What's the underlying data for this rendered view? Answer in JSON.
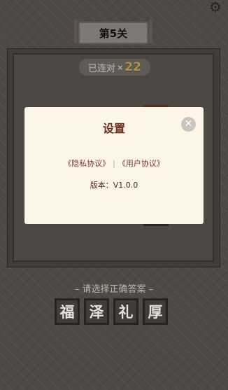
{
  "header": {
    "settings_icon": "gear-icon",
    "level_title": "第5关"
  },
  "streak": {
    "label": "已连对",
    "multiplier": "×",
    "count": "22"
  },
  "prompt": "– 请选择正确答案 –",
  "answers": [
    "福",
    "泽",
    "礼",
    "厚"
  ],
  "modal": {
    "title": "设置",
    "close_icon": "close-icon",
    "privacy_link": "《隐私协议》",
    "separator": "|",
    "user_link": "《用户协议》",
    "version": "版本：V1.0.0"
  },
  "colors": {
    "modal_title": "#6b2c22",
    "modal_bg": "#fcf5e8",
    "streak_number": "#c8a35a"
  }
}
